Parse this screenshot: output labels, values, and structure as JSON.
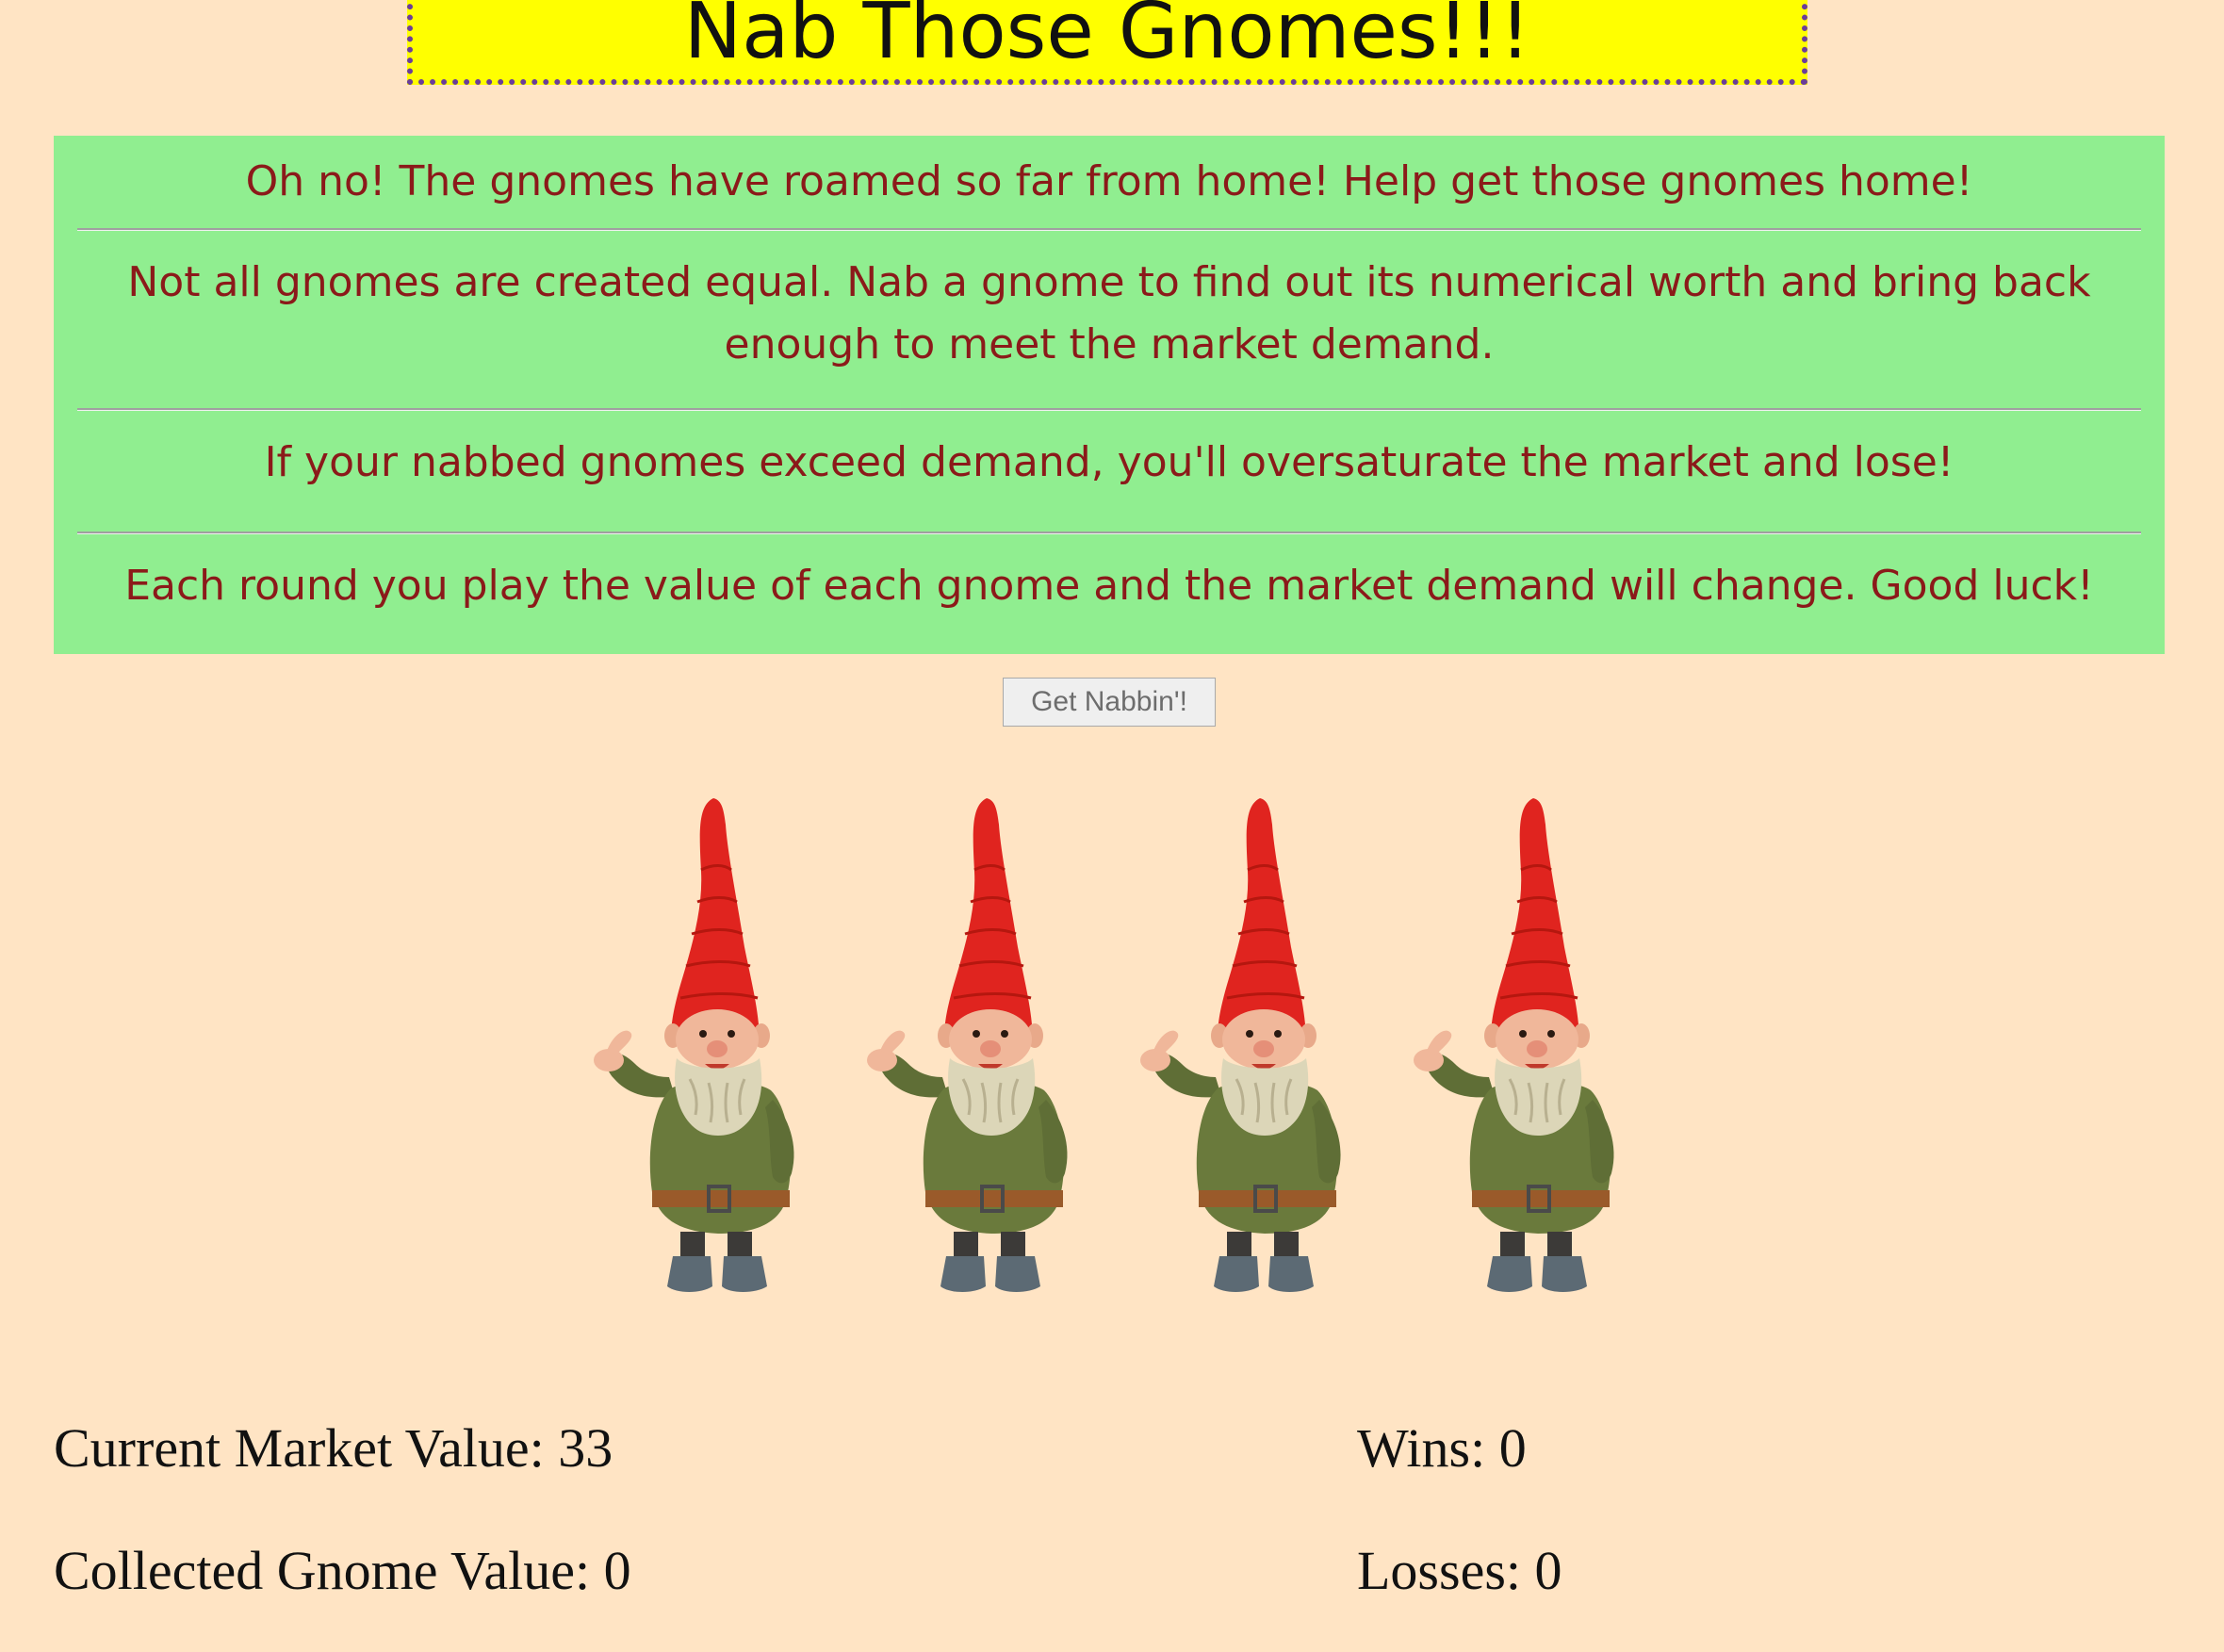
{
  "header": {
    "title": "Nab Those Gnomes!!!"
  },
  "instructions": [
    "Oh no! The gnomes have roamed so far from home! Help get those gnomes home!",
    "Not all gnomes are created equal. Nab a gnome to find out its numerical worth and bring back enough to meet the market demand.",
    "If your nabbed gnomes exceed demand, you'll oversaturate the market and lose!",
    "Each round you play the value of each gnome and the market demand will change. Good luck!"
  ],
  "start_button": {
    "label": "Get Nabbin'!"
  },
  "gnomes": [
    {
      "icon": "gnome-icon"
    },
    {
      "icon": "gnome-icon"
    },
    {
      "icon": "gnome-icon"
    },
    {
      "icon": "gnome-icon"
    }
  ],
  "stats": {
    "market_value": "Current Market Value: 33",
    "collected_value": "Collected Gnome Value: 0",
    "wins": "Wins: 0",
    "losses": "Losses: 0"
  },
  "colors": {
    "page_background": "#ffe4c4",
    "title_background": "#ffff00",
    "title_border": "#6a3d9a",
    "instructions_background": "#90ee90",
    "instructions_text": "#8b1a1a"
  }
}
